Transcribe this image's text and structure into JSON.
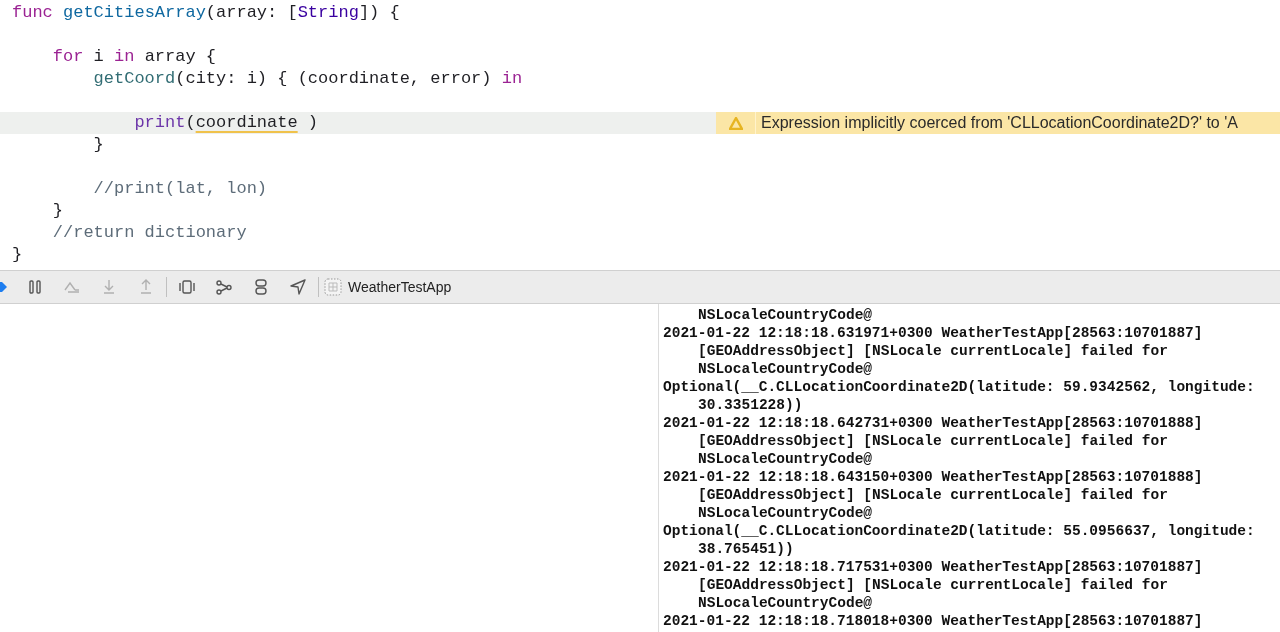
{
  "editor": {
    "lines": [
      {
        "kind": "code",
        "tokens": [
          {
            "text": "func",
            "kind": "keyword"
          },
          {
            "text": " getCitiesArray",
            "kind": "decl"
          },
          {
            "text": "(array: [",
            "kind": "plain"
          },
          {
            "text": "String",
            "kind": "type"
          },
          {
            "text": "]) {",
            "kind": "plain"
          }
        ]
      },
      {
        "kind": "blank"
      },
      {
        "kind": "code",
        "tokens": [
          {
            "text": "    for",
            "kind": "keyword"
          },
          {
            "text": " i ",
            "kind": "plain"
          },
          {
            "text": "in",
            "kind": "keyword"
          },
          {
            "text": " array {",
            "kind": "plain"
          }
        ]
      },
      {
        "kind": "code",
        "tokens": [
          {
            "text": "        getCoord",
            "kind": "call"
          },
          {
            "text": "(city: i) { (coordinate, error) ",
            "kind": "plain"
          },
          {
            "text": "in",
            "kind": "keyword"
          }
        ]
      },
      {
        "kind": "blank"
      },
      {
        "kind": "code",
        "highlighted": true,
        "warning": "Expression implicitly coerced from 'CLLocationCoordinate2D?' to 'A",
        "tokens": [
          {
            "text": "            print",
            "kind": "system"
          },
          {
            "text": "(",
            "kind": "plain"
          },
          {
            "text": "coordinate",
            "kind": "flagged"
          },
          {
            "text": " )",
            "kind": "plain"
          }
        ]
      },
      {
        "kind": "code",
        "tokens": [
          {
            "text": "        }",
            "kind": "plain"
          }
        ]
      },
      {
        "kind": "blank"
      },
      {
        "kind": "code",
        "tokens": [
          {
            "text": "        //print(lat, lon)",
            "kind": "comment"
          }
        ]
      },
      {
        "kind": "code",
        "tokens": [
          {
            "text": "    }",
            "kind": "plain"
          }
        ]
      },
      {
        "kind": "code",
        "tokens": [
          {
            "text": "    //return dictionary",
            "kind": "comment"
          }
        ]
      },
      {
        "kind": "code",
        "tokens": [
          {
            "text": "}",
            "kind": "plain"
          }
        ]
      }
    ]
  },
  "debug_bar": {
    "scheme": "WeatherTestApp"
  },
  "console": {
    "lines": [
      {
        "text": "NSLocaleCountryCode@",
        "continuation": true
      },
      {
        "text": "2021-01-22 12:18:18.631971+0300 WeatherTestApp[28563:10701887]",
        "continuation": false
      },
      {
        "text": "[GEOAddressObject] [NSLocale currentLocale] failed for",
        "continuation": true
      },
      {
        "text": "NSLocaleCountryCode@",
        "continuation": true
      },
      {
        "text": "Optional(__C.CLLocationCoordinate2D(latitude: 59.9342562, longitude:",
        "continuation": false
      },
      {
        "text": "30.3351228))",
        "continuation": true
      },
      {
        "text": "2021-01-22 12:18:18.642731+0300 WeatherTestApp[28563:10701888]",
        "continuation": false
      },
      {
        "text": "[GEOAddressObject] [NSLocale currentLocale] failed for",
        "continuation": true
      },
      {
        "text": "NSLocaleCountryCode@",
        "continuation": true
      },
      {
        "text": "2021-01-22 12:18:18.643150+0300 WeatherTestApp[28563:10701888]",
        "continuation": false
      },
      {
        "text": "[GEOAddressObject] [NSLocale currentLocale] failed for",
        "continuation": true
      },
      {
        "text": "NSLocaleCountryCode@",
        "continuation": true
      },
      {
        "text": "Optional(__C.CLLocationCoordinate2D(latitude: 55.0956637, longitude:",
        "continuation": false
      },
      {
        "text": "38.765451))",
        "continuation": true
      },
      {
        "text": "2021-01-22 12:18:18.717531+0300 WeatherTestApp[28563:10701887]",
        "continuation": false
      },
      {
        "text": "[GEOAddressObject] [NSLocale currentLocale] failed for",
        "continuation": true
      },
      {
        "text": "NSLocaleCountryCode@",
        "continuation": true
      },
      {
        "text": "2021-01-22 12:18:18.718018+0300 WeatherTestApp[28563:10701887]",
        "continuation": false
      }
    ]
  }
}
